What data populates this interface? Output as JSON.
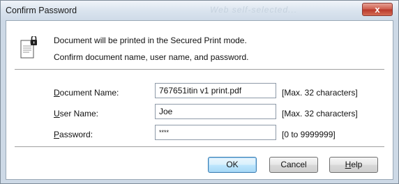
{
  "window": {
    "title": "Confirm Password",
    "background_ghost_text": "Web self-selected...",
    "close_symbol": "x"
  },
  "message": {
    "line1": "Document will be printed in the Secured Print mode.",
    "line2": "Confirm document name, user name, and password.",
    "icon": "secured-document-lock-icon"
  },
  "fields": {
    "document_name": {
      "label_prefix": "D",
      "label_rest": "ocument Name:",
      "value": "767651itin v1 print.pdf",
      "hint": "[Max. 32 characters]"
    },
    "user_name": {
      "label_prefix": "U",
      "label_rest": "ser Name:",
      "value": "Joe",
      "hint": "[Max. 32 characters]"
    },
    "password": {
      "label_prefix": "P",
      "label_rest": "assword:",
      "value": "****",
      "hint": "[0 to 9999999]"
    }
  },
  "buttons": {
    "ok": "OK",
    "cancel": "Cancel",
    "help_prefix": "H",
    "help_rest": "elp"
  },
  "colors": {
    "frame": "#cdd9e6",
    "default_button_border": "#3c7fb1",
    "close_button": "#cc5a49"
  }
}
